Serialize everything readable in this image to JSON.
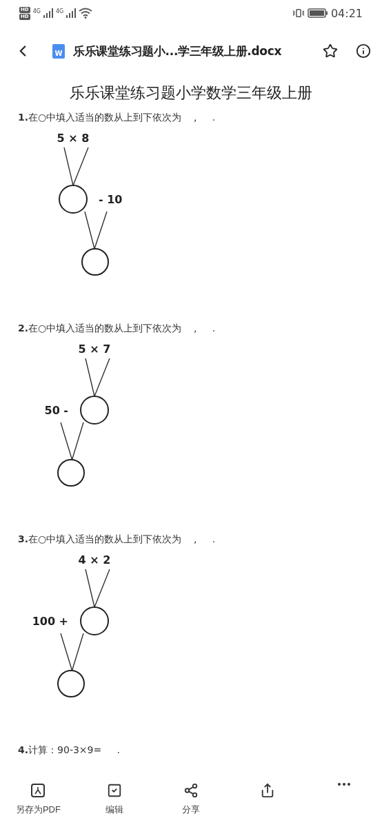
{
  "status_bar": {
    "sim_badges": [
      "HD",
      "HD"
    ],
    "signals": [
      "4G",
      "4G"
    ],
    "time": "04:21"
  },
  "header": {
    "file_icon_letter": "W",
    "title": "乐乐课堂练习题小...学三年级上册.docx"
  },
  "document": {
    "title": "乐乐课堂练习题小学数学三年级上册",
    "questions": [
      {
        "kind": "tree_right",
        "text": "**1.**在○中填入适当的数从上到下依次为    ,     .",
        "top_expression": "5 × 8",
        "operand": "- 10"
      },
      {
        "kind": "tree_left",
        "text": "**2.**在○中填入适当的数从上到下依次为    ,     .",
        "top_expression": "5 × 7",
        "operand": "50 -"
      },
      {
        "kind": "tree_left",
        "text": "**3.**在○中填入适当的数从上到下依次为    ,     .",
        "top_expression": "4 × 2",
        "operand": "100 +"
      },
      {
        "kind": "line",
        "text": "**4.**计算：90-3×9=     ."
      }
    ]
  },
  "toolbar": [
    {
      "kind": "pdf",
      "label": "另存为PDF"
    },
    {
      "kind": "edit",
      "label": "编辑"
    },
    {
      "kind": "share",
      "label": "分享"
    },
    {
      "kind": "export"
    },
    {
      "kind": "more"
    }
  ]
}
